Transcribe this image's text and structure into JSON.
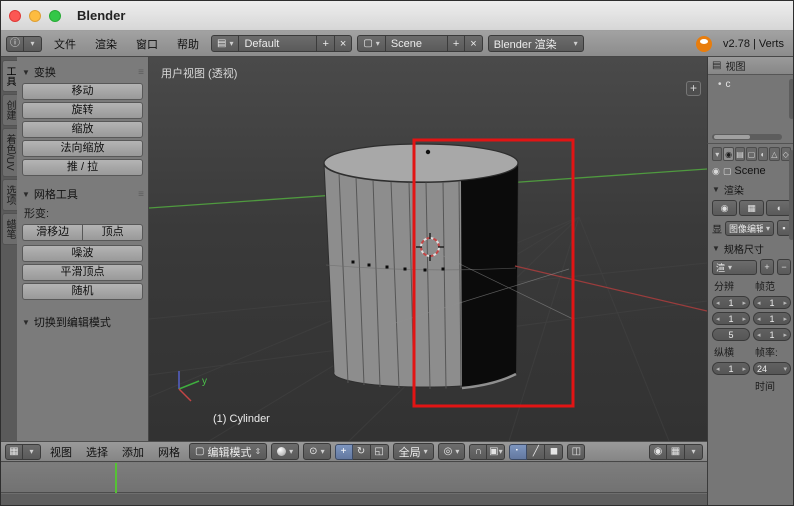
{
  "window": {
    "title": "Blender"
  },
  "info_bar": {
    "menus": [
      {
        "label": "文件"
      },
      {
        "label": "渲染"
      },
      {
        "label": "窗口"
      },
      {
        "label": "帮助"
      }
    ],
    "layout_selector": {
      "value": "Default"
    },
    "scene_selector": {
      "value": "Scene"
    },
    "engine_selector": {
      "value": "Blender 渲染"
    },
    "stats": "v2.78 | Verts"
  },
  "tool_shelf": {
    "tabs": [
      {
        "label": "工具"
      },
      {
        "label": "创建"
      },
      {
        "label": "着色/UV"
      },
      {
        "label": "选项"
      },
      {
        "label": "蜡笔"
      }
    ],
    "transform_panel": {
      "title": "变换",
      "buttons": [
        "移动",
        "旋转",
        "缩放",
        "法向缩放",
        "推 / 拉"
      ]
    },
    "mesh_tools_panel": {
      "title": "网格工具",
      "deform_label": "形变:",
      "split_buttons": [
        "滑移边",
        "顶点"
      ],
      "buttons": [
        "噪波",
        "平滑顶点",
        "随机"
      ]
    },
    "extra_panel": {
      "title": "切换到编辑模式"
    }
  },
  "viewport": {
    "view_label": "用户视图 (透视)",
    "object_info": "(1) Cylinder",
    "axis_y_label": "y",
    "annotation_color": "#e21414"
  },
  "viewport_header": {
    "menus": [
      {
        "label": "视图"
      },
      {
        "label": "选择"
      },
      {
        "label": "添加"
      },
      {
        "label": "网格"
      }
    ],
    "mode_selector": {
      "value": "编辑模式"
    },
    "orientation_selector": {
      "value": "全局"
    }
  },
  "timeline": {
    "marker_color": "#55c234"
  },
  "outliner": {
    "header_menu": "视图",
    "items": [
      {
        "label": "c"
      }
    ]
  },
  "properties": {
    "context": {
      "label": "Scene"
    },
    "render_panel": {
      "title": "渲染",
      "display_label": "显",
      "display_value": "图像编辑器"
    },
    "dimensions_panel": {
      "title": "规格尺寸",
      "preset_value": "渲",
      "resolution_label": "分辨",
      "frame_range_label": "帧范",
      "res_x": "1",
      "res_y": "1",
      "frame_start": "1",
      "frame_end": "1",
      "percent": "5",
      "frame_step": "1",
      "aspect_label": "纵横",
      "framerate_label": "帧率:",
      "aspect_x": "1",
      "fps": "24",
      "time_label": "时间"
    }
  },
  "icons": {
    "info": "ⓘ",
    "screen": "▤",
    "scene": "▢",
    "dropdown": "▾",
    "updown": "⇕",
    "plus": "+",
    "close": "×",
    "collapse": "▼",
    "grip": "≡",
    "editor_grid": "▦",
    "mode_cube": "▢",
    "pivot": "⊙",
    "translate": "+",
    "rotate": "↻",
    "scale": "◱",
    "prop_edit": "◎",
    "magnet": "∩",
    "snap_element": "▣",
    "vertex": "⠂",
    "edge": "╱",
    "face": "◼",
    "occlude": "◫",
    "camera": "◉",
    "clapper": "▦",
    "speaker": "◖",
    "lock": "▪",
    "pin": "◉",
    "arrow_left": "◂",
    "arrow_right": "▸",
    "tree_dot": "•",
    "world": "◐",
    "image": "▤",
    "data": "△",
    "material": "◇"
  }
}
